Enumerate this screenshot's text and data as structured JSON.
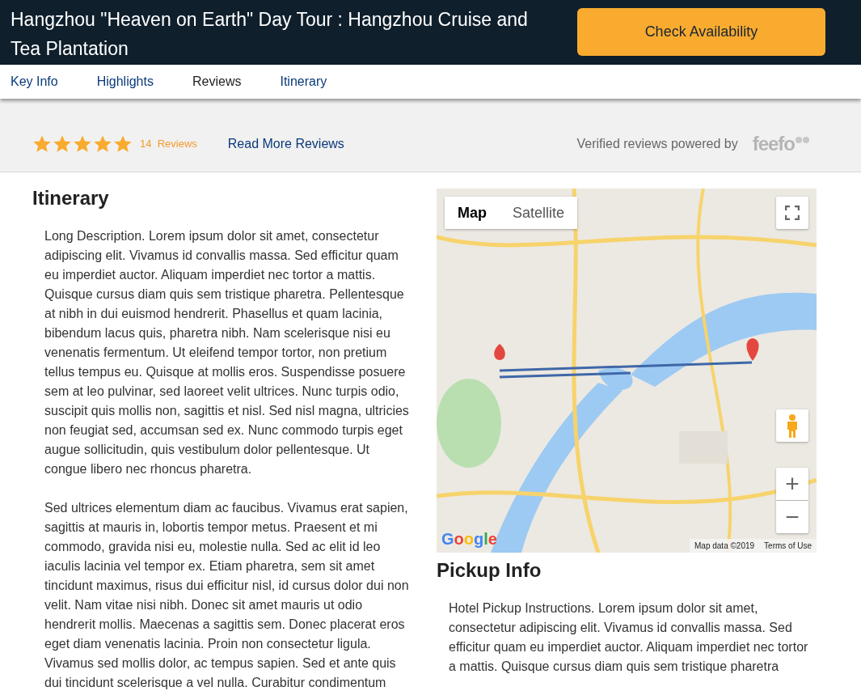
{
  "header": {
    "title": "Hangzhou \"Heaven on Earth\" Day Tour : Hangzhou Cruise and Tea Plantation",
    "button": "Check Availability"
  },
  "nav": [
    {
      "label": "Key Info",
      "selected": false
    },
    {
      "label": "Highlights",
      "selected": false
    },
    {
      "label": "Reviews",
      "selected": true
    },
    {
      "label": "Itinerary",
      "selected": false
    }
  ],
  "reviews": {
    "stars": 5,
    "count": "14",
    "count_label": "Reviews",
    "link": "Read More Reviews",
    "verified": "Verified reviews powered by",
    "logo": "feefo"
  },
  "itinerary": {
    "heading": "Itinerary",
    "paragraphs": [
      "Long Description. Lorem ipsum dolor sit amet, consectetur adipiscing elit. Vivamus id convallis massa. Sed efficitur quam eu imperdiet auctor. Aliquam imperdiet nec tortor a mattis. Quisque cursus diam quis sem tristique pharetra. Pellentesque at nibh in dui euismod hendrerit. Phasellus et quam lacinia, bibendum lacus quis, pharetra nibh. Nam scelerisque nisi eu venenatis fermentum. Ut eleifend tempor tortor, non pretium tellus tempus eu. Quisque at mollis eros. Suspendisse posuere sem at leo pulvinar, sed laoreet velit ultrices. Nunc turpis odio, suscipit quis mollis non, sagittis et nisl. Sed nisl magna, ultricies non feugiat sed, accumsan sed ex. Nunc commodo turpis eget augue sollicitudin, quis vestibulum dolor pellentesque. Ut congue libero nec rhoncus pharetra.",
      "Sed ultrices elementum diam ac faucibus. Vivamus erat sapien, sagittis at mauris in, lobortis tempor metus. Praesent et mi commodo, gravida nisi eu, molestie nulla. Sed ac elit id leo iaculis lacinia vel tempor ex. Etiam pharetra, sem sit amet tincidunt maximus, risus dui efficitur nisl, id cursus dolor dui non velit. Nam vitae nisi nibh. Donec sit amet mauris ut odio hendrerit mollis. Maecenas a sagittis sem. Donec placerat eros eget diam venenatis lacinia. Proin non consectetur ligula. Vivamus sed mollis dolor, ac tempus sapien. Sed et ante quis dui tincidunt scelerisque a vel nulla. Curabitur condimentum"
    ]
  },
  "map": {
    "kind": "picture",
    "types": [
      {
        "label": "Map",
        "selected": true
      },
      {
        "label": "Satellite",
        "selected": false
      }
    ],
    "zoom_in": "+",
    "zoom_out": "−",
    "logo": "Google",
    "attribution": "Map data ©2019",
    "terms": "Terms of Use"
  },
  "pickup": {
    "heading": "Pickup Info",
    "text": "Hotel Pickup Instructions. Lorem ipsum dolor sit amet, consectetur adipiscing elit. Vivamus id convallis massa. Sed efficitur quam eu imperdiet auctor. Aliquam imperdiet nec tortor a mattis. Quisque cursus diam quis sem tristique pharetra"
  }
}
